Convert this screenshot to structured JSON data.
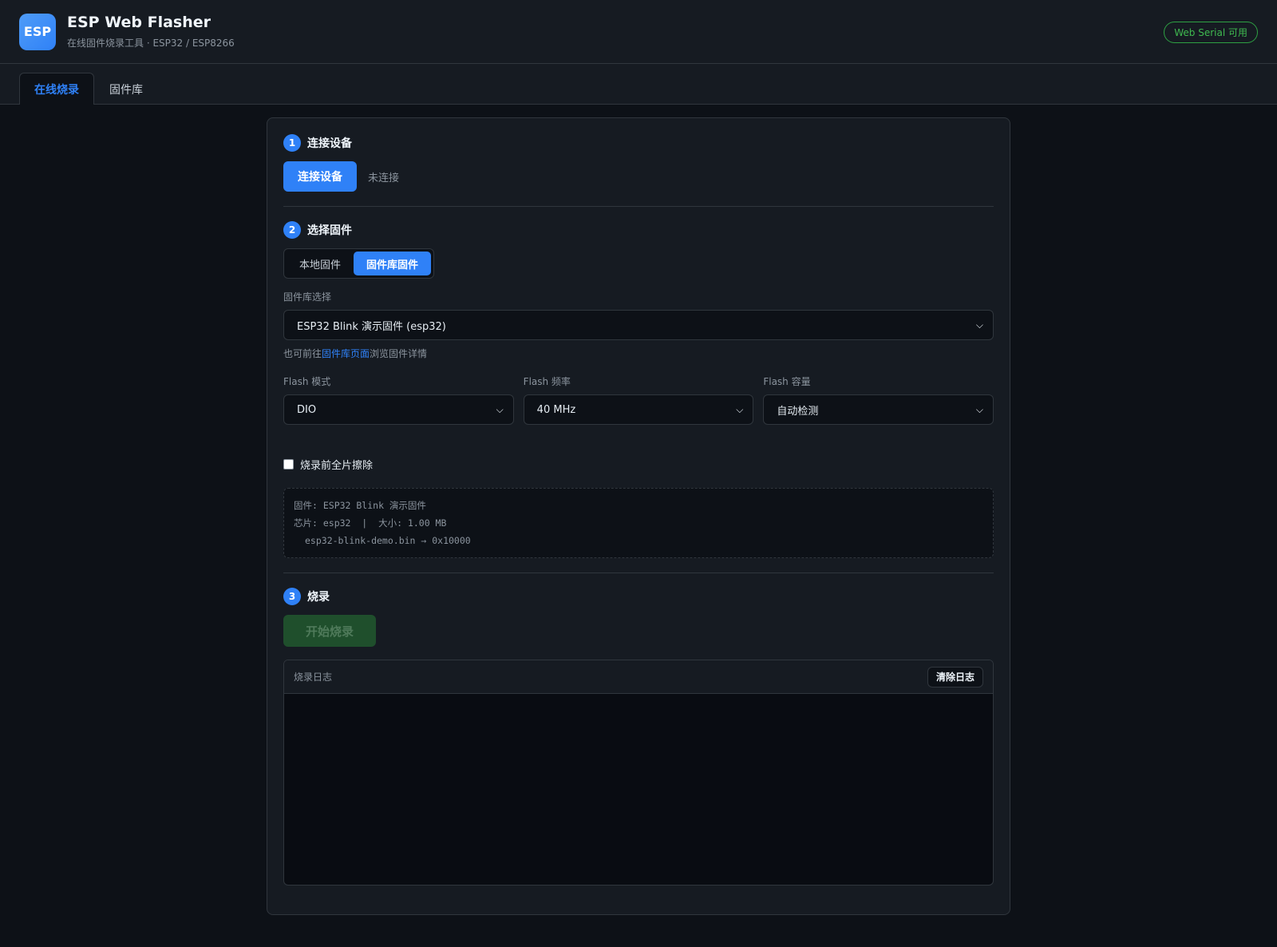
{
  "app": {
    "logo_text": "ESP",
    "title": "ESP Web Flasher",
    "subtitle": "在线固件烧录工具 · ESP32 / ESP8266",
    "serial_badge": "Web Serial 可用"
  },
  "tabs": [
    {
      "label": "在线烧录",
      "active": true
    },
    {
      "label": "固件库",
      "active": false
    }
  ],
  "step1": {
    "num": "1",
    "title": "连接设备",
    "connect_button": "连接设备",
    "status": "未连接"
  },
  "step2": {
    "num": "2",
    "title": "选择固件",
    "source_options": [
      {
        "label": "本地固件",
        "active": false
      },
      {
        "label": "固件库固件",
        "active": true
      }
    ],
    "library_label": "固件库选择",
    "library_value": "ESP32 Blink 演示固件 (esp32)",
    "hint_prefix": "也可前往",
    "hint_link": "固件库页面",
    "hint_suffix": "浏览固件详情",
    "flash_mode_label": "Flash 模式",
    "flash_mode_value": "DIO",
    "flash_freq_label": "Flash 频率",
    "flash_freq_value": "40 MHz",
    "flash_size_label": "Flash 容量",
    "flash_size_value": "自动检测",
    "erase_label": "烧录前全片擦除",
    "erase_checked": false,
    "info_line1": "固件: ESP32 Blink 演示固件",
    "info_line2": "芯片: esp32  |  大小: 1.00 MB",
    "info_line3": "esp32-blink-demo.bin → 0x10000"
  },
  "step3": {
    "num": "3",
    "title": "烧录",
    "flash_button": "开始烧录",
    "log_title": "烧录日志",
    "clear_button": "清除日志"
  },
  "colors": {
    "accent": "#2f81f7",
    "success": "#3fb950",
    "background": "#0d1117",
    "panel": "#161b22"
  }
}
